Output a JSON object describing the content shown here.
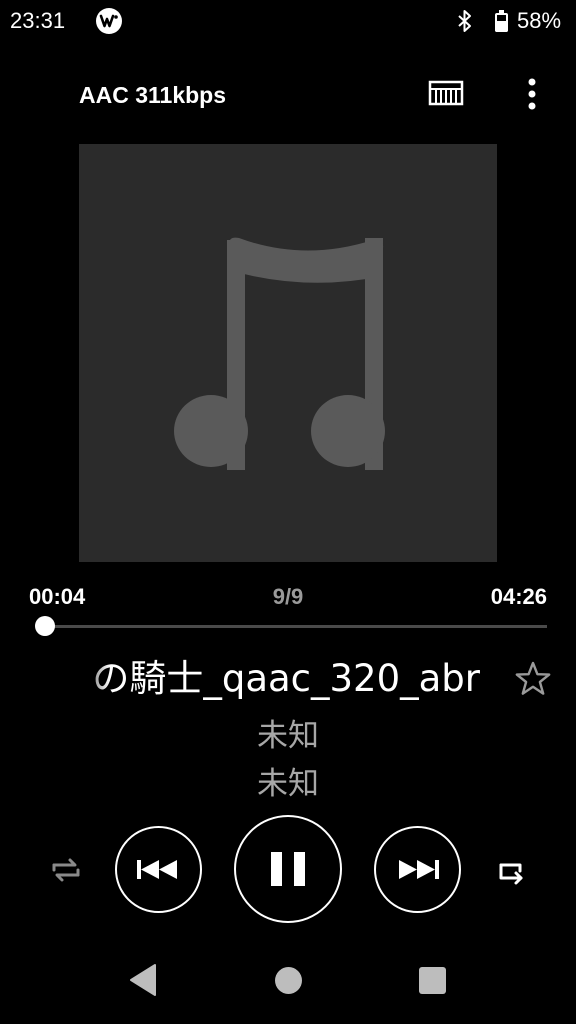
{
  "status_bar": {
    "time": "23:31",
    "battery_percent": "58%",
    "battery_level": 0.58,
    "icons": [
      "walkman-icon",
      "bluetooth-icon",
      "battery-icon"
    ]
  },
  "header": {
    "codec": "AAC 311kbps",
    "icons": [
      "equalizer-icon",
      "more-options-icon"
    ]
  },
  "artwork": {
    "icon": "music-note-icon",
    "background_color": "#2b2b2b",
    "note_color": "#5a5a5a"
  },
  "progress": {
    "elapsed": "00:04",
    "track_position": "9/9",
    "total": "04:26",
    "fraction": 0.015
  },
  "track": {
    "title": "の騎士_qaac_320_abr",
    "artist": "未知",
    "album": "未知"
  },
  "controls": {
    "icons": [
      "shuffle-icon",
      "previous-icon",
      "pause-icon",
      "next-icon",
      "repeat-icon",
      "favorite-star-icon"
    ]
  },
  "nav_bar": {
    "icons": [
      "back-icon",
      "home-icon",
      "recents-icon"
    ]
  }
}
